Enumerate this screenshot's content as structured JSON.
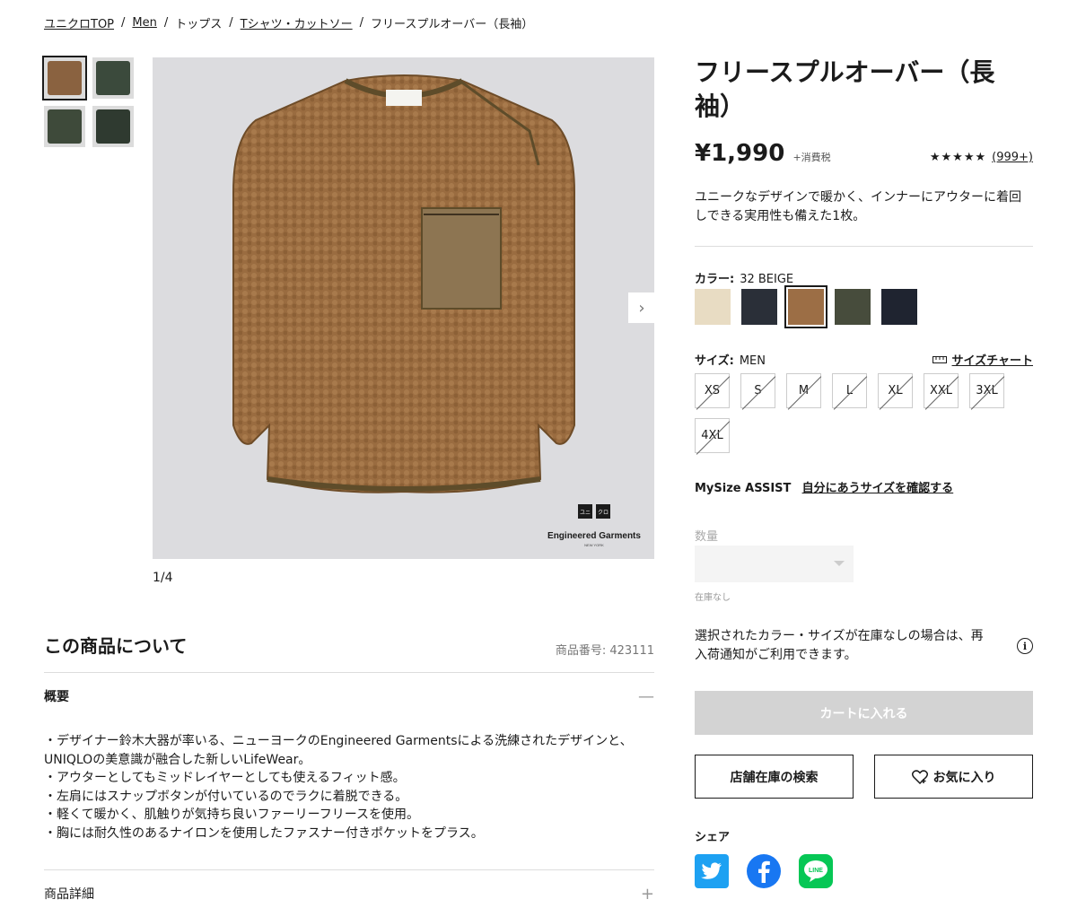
{
  "breadcrumb": [
    {
      "label": "ユニクロTOP",
      "link": true
    },
    {
      "label": "Men",
      "link": true
    },
    {
      "label": "トップス",
      "link": false
    },
    {
      "label": "Tシャツ・カットソー",
      "link": true
    },
    {
      "label": "フリースプルオーバー（長袖）",
      "link": false
    }
  ],
  "gallery": {
    "counter": "1/4",
    "next_glyph": "›",
    "thumb_colors": [
      "#8a6240",
      "#3b4a3c",
      "#3e4a3a",
      "#2f3a30"
    ],
    "brand_logo": "ユニ クロ",
    "brand_name": "Engineered Garments",
    "brand_city": "NEW YORK"
  },
  "product": {
    "title": "フリースプルオーバー（長袖）",
    "price": "¥1,990",
    "tax": "+消費税",
    "stars": "★★★★★",
    "review_count": "(999+)",
    "description": "ユニークなデザインで暖かく、インナーにアウターに着回しできる実用性も備えた1枚。"
  },
  "color": {
    "label": "カラー:",
    "value": "32 BEIGE",
    "swatches": [
      "#e8dcc3",
      "#2a2f38",
      "#9c6e45",
      "#474c3c",
      "#1f2430"
    ]
  },
  "size": {
    "label": "サイズ:",
    "value": "MEN",
    "chart_label": "サイズチャート",
    "options": [
      "XS",
      "S",
      "M",
      "L",
      "XL",
      "XXL",
      "3XL",
      "4XL"
    ]
  },
  "mysize": {
    "label": "MySize ASSIST",
    "link": "自分にあうサイズを確認する"
  },
  "quantity": {
    "label": "数量",
    "stock": "在庫なし"
  },
  "notice": "選択されたカラー・サイズが在庫なしの場合は、再入荷通知がご利用できます。",
  "buttons": {
    "cart": "カートに入れる",
    "store": "店舗在庫の検索",
    "favorite": "お気に入り"
  },
  "share": {
    "label": "シェア",
    "line_text": "LINE"
  },
  "about": {
    "title": "この商品について",
    "product_no": "商品番号: 423111",
    "overview_label": "概要",
    "overview_ctl": "—",
    "overview_lines": [
      "・デザイナー鈴木大器が率いる、ニューヨークのEngineered Garmentsによる洗練されたデザインと、UNIQLOの美意識が融合した新しいLifeWear。",
      "・アウターとしてもミッドレイヤーとしても使えるフィット感。",
      "・左肩にはスナップボタンが付いているのでラクに着脱できる。",
      "・軽くて暖かく、肌触りが気持ち良いファーリーフリースを使用。",
      "・胸には耐久性のあるナイロンを使用したファスナー付きポケットをプラス。"
    ],
    "details_label": "商品詳細",
    "details_ctl": "+"
  },
  "colors_ui": {
    "twitter": "#1da1f2",
    "facebook": "#1877f2",
    "line": "#06c755"
  }
}
